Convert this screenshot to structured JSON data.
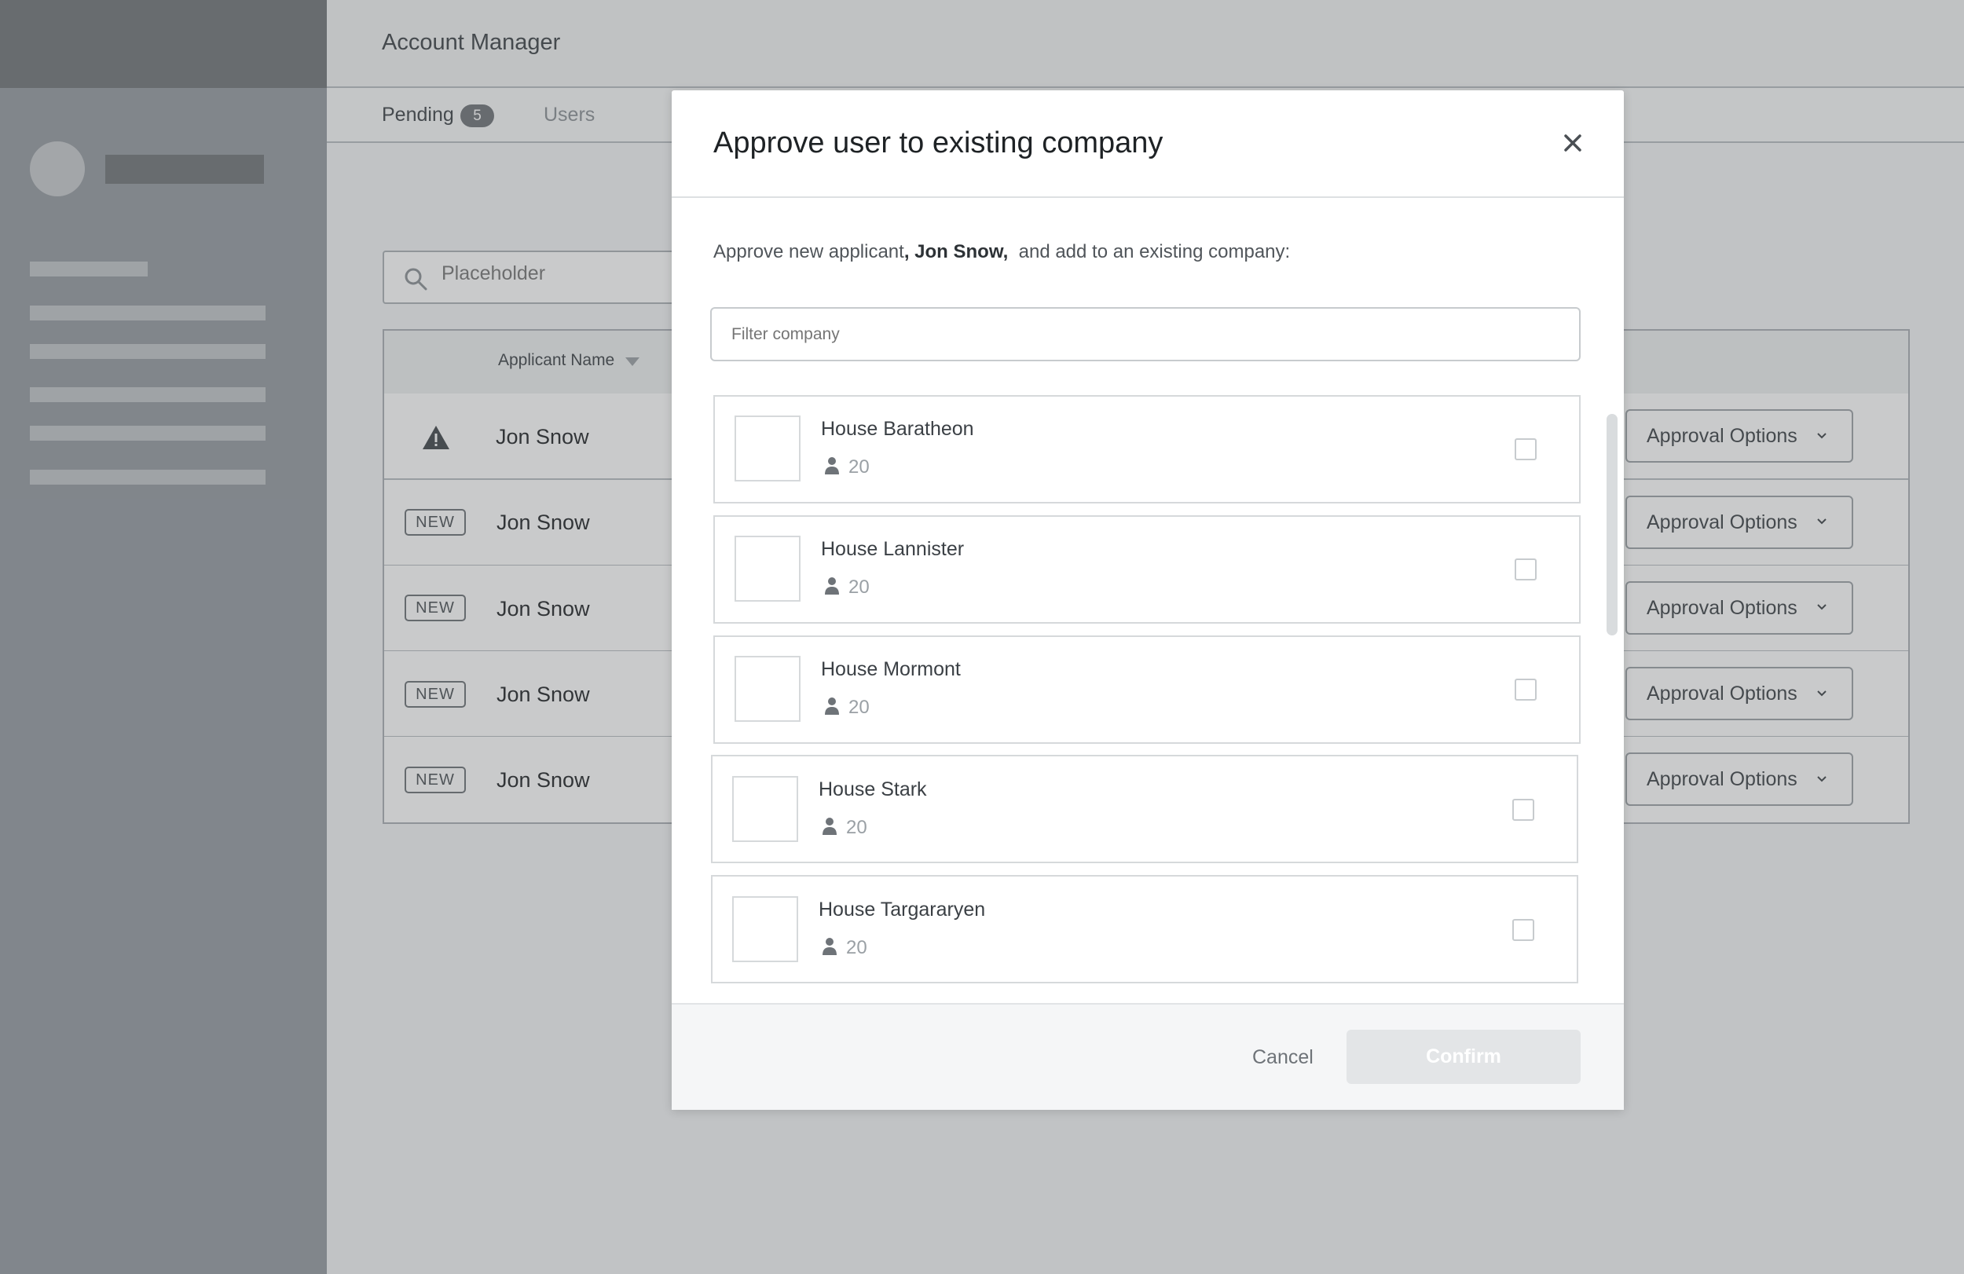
{
  "header": {
    "title": "Account Manager"
  },
  "tabs": [
    {
      "label": "Pending",
      "count": "5"
    },
    {
      "label": "Users"
    }
  ],
  "search": {
    "placeholder": "Placeholder"
  },
  "table": {
    "columns": {
      "applicant_name": "Applicant Name"
    },
    "rows": [
      {
        "badge": "",
        "status_icon": "warning-icon",
        "name": "Jon Snow",
        "action": "Approval Options"
      },
      {
        "badge": "NEW",
        "name": "Jon Snow",
        "action": "Approval Options"
      },
      {
        "badge": "NEW",
        "name": "Jon Snow",
        "action": "Approval Options"
      },
      {
        "badge": "NEW",
        "name": "Jon Snow",
        "action": "Approval Options"
      },
      {
        "badge": "NEW",
        "name": "Jon Snow",
        "action": "Approval Options"
      }
    ]
  },
  "modal": {
    "title": "Approve user to existing company",
    "description_prefix": "Approve new applicant",
    "description_name": ", Jon Snow,",
    "description_suffix": "  and add to an existing company:",
    "filter_placeholder": "Filter company",
    "companies": [
      {
        "name": "House Baratheon",
        "members": "20"
      },
      {
        "name": "House Lannister",
        "members": "20"
      },
      {
        "name": "House Mormont",
        "members": "20"
      },
      {
        "name": "House Stark",
        "members": "20"
      },
      {
        "name": "House Targararyen",
        "members": "20"
      }
    ],
    "cancel_label": "Cancel",
    "confirm_label": "Confirm"
  }
}
